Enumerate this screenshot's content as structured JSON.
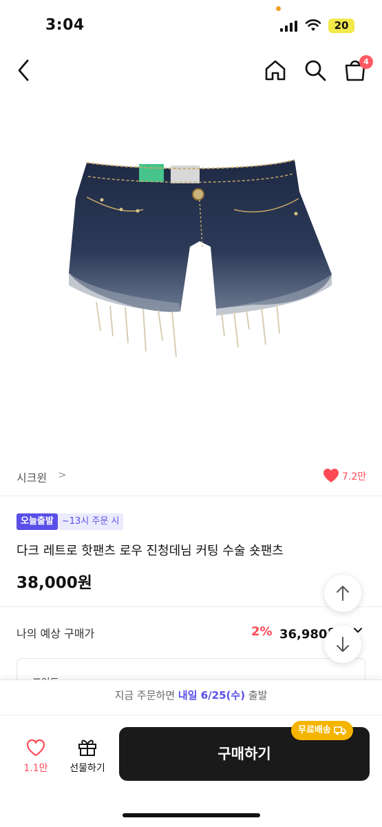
{
  "status": {
    "time": "3:04",
    "battery": "20"
  },
  "nav": {
    "cart_count": "4"
  },
  "seller": {
    "name": "시크윈",
    "arrow": ">",
    "likes": "7.2만"
  },
  "product": {
    "badge": "오늘출발",
    "badge_note": "~13시 주문 시",
    "title": "다크 레트로 핫팬츠 로우 진청데님 커팅 수술 숏팬츠",
    "price": "38,000원"
  },
  "estimate": {
    "label": "나의 예상 구매가",
    "discount": "2%",
    "price": "36,980원"
  },
  "point": {
    "label": "포인트"
  },
  "shipping": {
    "prefix": "지금 주문하면",
    "date": "내일 6/25(수)",
    "suffix": "출발"
  },
  "bottom": {
    "wish_count": "1.1만",
    "gift_label": "선물하기",
    "buy_label": "구매하기",
    "free_ship": "무료배송"
  },
  "colors": {
    "accent": "#5a4fe8",
    "heart": "#ff4a55",
    "free_ship": "#f4b400",
    "buy_button": "#1a1a1a"
  }
}
